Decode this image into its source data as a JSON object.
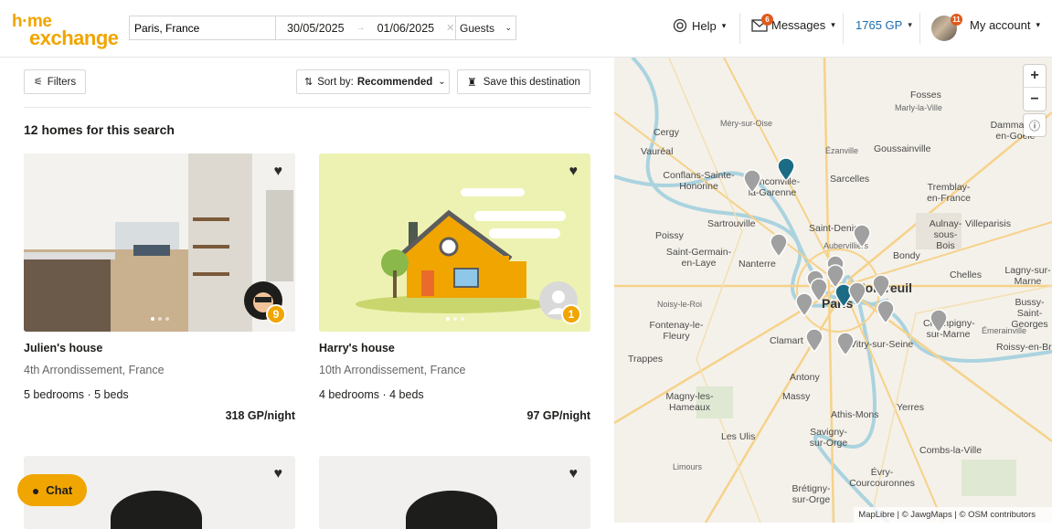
{
  "header": {
    "logo_top": "h·me",
    "logo_bottom": "exchange",
    "search_value": "Paris, France",
    "checkin": "30/05/2025",
    "checkout": "01/06/2025",
    "guests_label": "Guests",
    "help_label": "Help",
    "messages_label": "Messages",
    "messages_count": "6",
    "gp_label": "1765 GP",
    "account_label": "My account",
    "account_count": "11"
  },
  "toolbar": {
    "filters_label": "Filters",
    "sort_prefix": "Sort by:",
    "sort_value": "Recommended",
    "save_label": "Save this destination"
  },
  "results": {
    "count_label": "12 homes for this search"
  },
  "cards": [
    {
      "title": "Julien's house",
      "location": "4th Arrondissement, France",
      "beds": "5 bedrooms · 5 beds",
      "price": "318 GP/night",
      "medal": "9"
    },
    {
      "title": "Harry's house",
      "location": "10th Arrondissement, France",
      "beds": "4 bedrooms · 4 beds",
      "price": "97 GP/night",
      "medal": "1"
    }
  ],
  "chat_label": "Chat",
  "map": {
    "labels": [
      "Fosses",
      "Marly-la-Ville",
      "Dammartin-en-Goële",
      "Méry-sur-Oise",
      "Cergy",
      "Vauréal",
      "Ézanville",
      "Goussainville",
      "Conflans-Sainte-Honorine",
      "Franconville-la-Garenne",
      "Sarcelles",
      "Tremblay-en-France",
      "Sartrouville",
      "Saint-Denis",
      "Aulnay-sous-Bois",
      "Villeparisis",
      "Poissy",
      "Saint-Germain-en-Laye",
      "Aubervilliers",
      "Bondy",
      "Nanterre",
      "Chelles",
      "Lagny-sur-Marne",
      "Noisy-le-Roi",
      "Paris",
      "Montreuil",
      "Bussy-Saint-Georges",
      "Fontenay-le-Fleury",
      "Clamart",
      "Champigny-sur-Marne",
      "Émerainville",
      "Vitry-sur-Seine",
      "Roissy-en-Brie",
      "Trappes",
      "Antony",
      "Massy",
      "Magny-les-Hameaux",
      "Yerres",
      "Athis-Mons",
      "Les Ulis",
      "Savigny-sur-Orge",
      "Combs-la-Ville",
      "Limours",
      "Évry-Courcouronnes",
      "Brétigny-sur-Orge"
    ],
    "attribution": "MapLibre | © JawgMaps | © OSM contributors"
  }
}
